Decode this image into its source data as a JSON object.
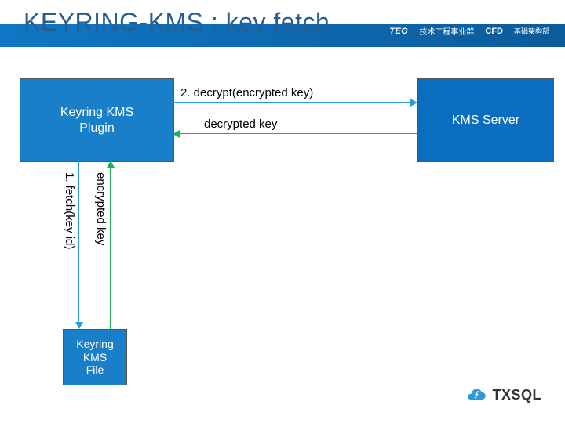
{
  "header": {
    "title": "KEYRING-KMS : key fetch",
    "teg": "TEG",
    "teg_cn": "技术工程事业群",
    "cfd": "CFD",
    "cfd_cn": "基础架构部"
  },
  "nodes": {
    "plugin": "Keyring KMS\nPlugin",
    "server": "KMS Server",
    "file": "Keyring\nKMS\nFile"
  },
  "arrows": {
    "decrypt_request": "2. decrypt(encrypted key)",
    "decrypt_response": "decrypted key",
    "fetch_request": "1. fetch(key id)",
    "fetch_response": "encrypted key"
  },
  "footer": {
    "product": "TXSQL"
  },
  "colors": {
    "header_gradient_start": "#0f77c6",
    "header_gradient_end": "#0c5b9a",
    "box_blue": "#1a7fc9",
    "server_blue": "#0a6ec0",
    "request_arrow": "#2a9bd8",
    "response_arrow": "#1db156"
  }
}
